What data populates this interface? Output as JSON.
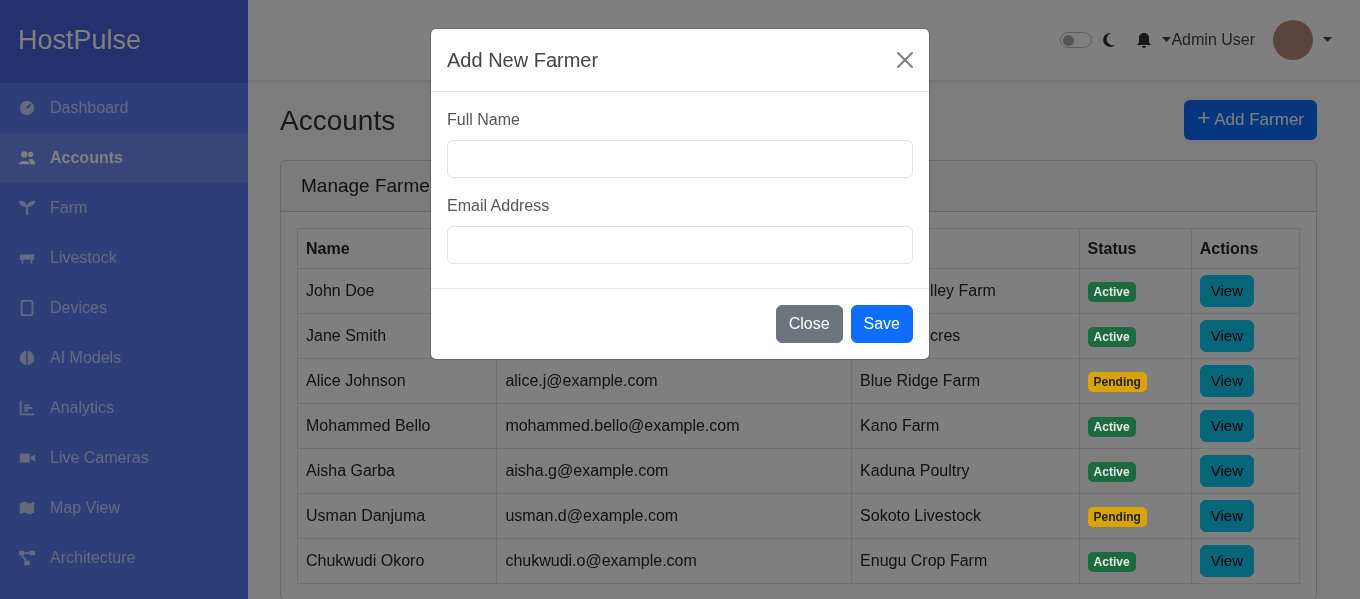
{
  "sidebar": {
    "brand": "HostPulse",
    "items": [
      {
        "label": "Dashboard",
        "selected": false
      },
      {
        "label": "Accounts",
        "selected": true
      },
      {
        "label": "Farm",
        "selected": false
      },
      {
        "label": "Livestock",
        "selected": false
      },
      {
        "label": "Devices",
        "selected": false
      },
      {
        "label": "AI Models",
        "selected": false
      },
      {
        "label": "Analytics",
        "selected": false
      },
      {
        "label": "Live Cameras",
        "selected": false
      },
      {
        "label": "Map View",
        "selected": false
      },
      {
        "label": "Architecture",
        "selected": false
      }
    ]
  },
  "topbar": {
    "dark_mode": false,
    "user": "Admin User"
  },
  "page": {
    "title": "Accounts",
    "add_button": "Add Farmer",
    "add_icon": "+"
  },
  "card": {
    "title": "Manage Farme"
  },
  "table": {
    "headers": {
      "name": "Name",
      "status": "Status",
      "actions": "Actions"
    },
    "rows": [
      {
        "name": "John Doe",
        "farm": "lley Farm",
        "farm_covered": true,
        "status": "Active",
        "action": "View"
      },
      {
        "name": "Jane Smith",
        "farm": "cres",
        "farm_covered": true,
        "status": "Active",
        "action": "View"
      },
      {
        "name": "Alice Johnson",
        "email": "alice.j@example.com",
        "farm": "Blue Ridge Farm",
        "farm_covered": false,
        "status": "Pending",
        "action": "View"
      },
      {
        "name": "Mohammed Bello",
        "email": "mohammed.bello@example.com",
        "farm": "Kano Farm",
        "farm_covered": false,
        "status": "Active",
        "action": "View"
      },
      {
        "name": "Aisha Garba",
        "email": "aisha.g@example.com",
        "farm": "Kaduna Poultry",
        "farm_covered": false,
        "status": "Active",
        "action": "View"
      },
      {
        "name": "Usman Danjuma",
        "email": "usman.d@example.com",
        "farm": "Sokoto Livestock",
        "farm_covered": false,
        "status": "Pending",
        "action": "View"
      },
      {
        "name": "Chukwudi Okoro",
        "email": "chukwudi.o@example.com",
        "farm": "Enugu Crop Farm",
        "farm_covered": false,
        "status": "Active",
        "action": "View"
      }
    ]
  },
  "modal": {
    "title": "Add New Farmer",
    "fields": [
      {
        "label": "Full Name"
      },
      {
        "label": "Email Address"
      }
    ],
    "buttons": [
      {
        "label": "Close",
        "kind": "secondary"
      },
      {
        "label": "Save",
        "kind": "primary"
      }
    ]
  }
}
